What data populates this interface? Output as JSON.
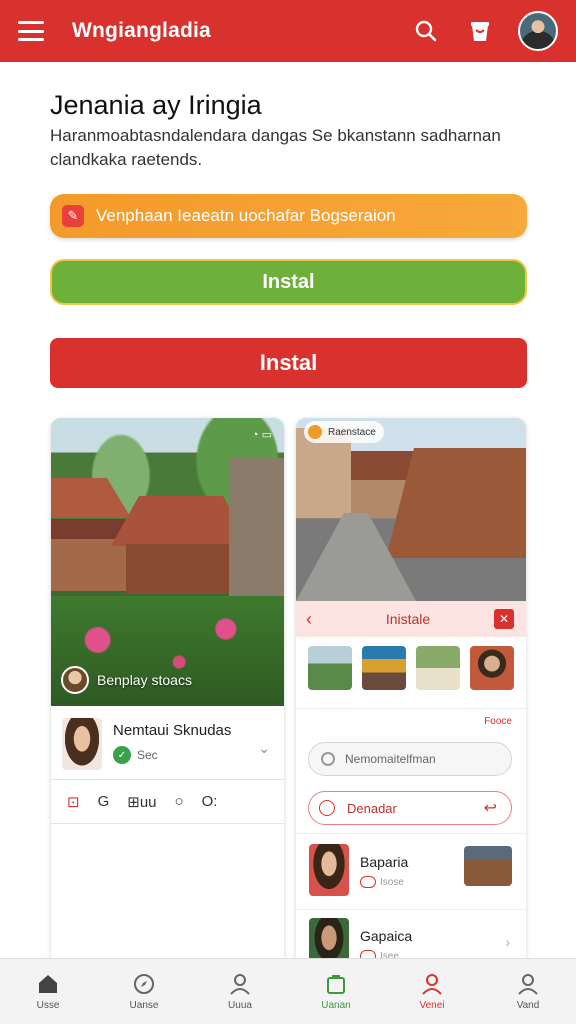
{
  "header": {
    "app_title": "Wngiangladia",
    "icons": [
      "menu-icon",
      "search-icon",
      "bag-icon",
      "avatar"
    ],
    "accent_color": "#d9322e"
  },
  "intro": {
    "title": "Jenania ay Iringia",
    "description": "Haranmoabtasndalendara dangas Se bkanstann sadharnan clandkaka raetends."
  },
  "buttons": {
    "orange_label": "Venphaan Ieaeatn uochafar Bogseraion",
    "green_label": "Instal",
    "red_label": "Instal"
  },
  "left_card": {
    "overlay_text": "Benplay stoacs",
    "profile_name": "Nemtaui Sknudas",
    "profile_sub": "Sec",
    "actions": [
      "⊡",
      "G",
      "⊞uu",
      "○",
      "O:"
    ]
  },
  "right_card": {
    "top_pill": "Raenstace",
    "sheet_title": "Inistale",
    "small_link": "Fooce",
    "search_placeholder": "Nemomaitelfman",
    "action_label": "Denadar",
    "list": [
      {
        "name": "Baparia",
        "sub": "Isose"
      },
      {
        "name": "Gapaica",
        "sub": "Isee"
      }
    ]
  },
  "bottom_nav": [
    {
      "label": "Usse",
      "icon": "home-icon"
    },
    {
      "label": "Uanse",
      "icon": "compass-icon"
    },
    {
      "label": "Uuua",
      "icon": "user-icon"
    },
    {
      "label": "Uanan",
      "icon": "bag-icon"
    },
    {
      "label": "Venei",
      "icon": "profile-icon"
    },
    {
      "label": "Vand",
      "icon": "account-icon"
    }
  ]
}
